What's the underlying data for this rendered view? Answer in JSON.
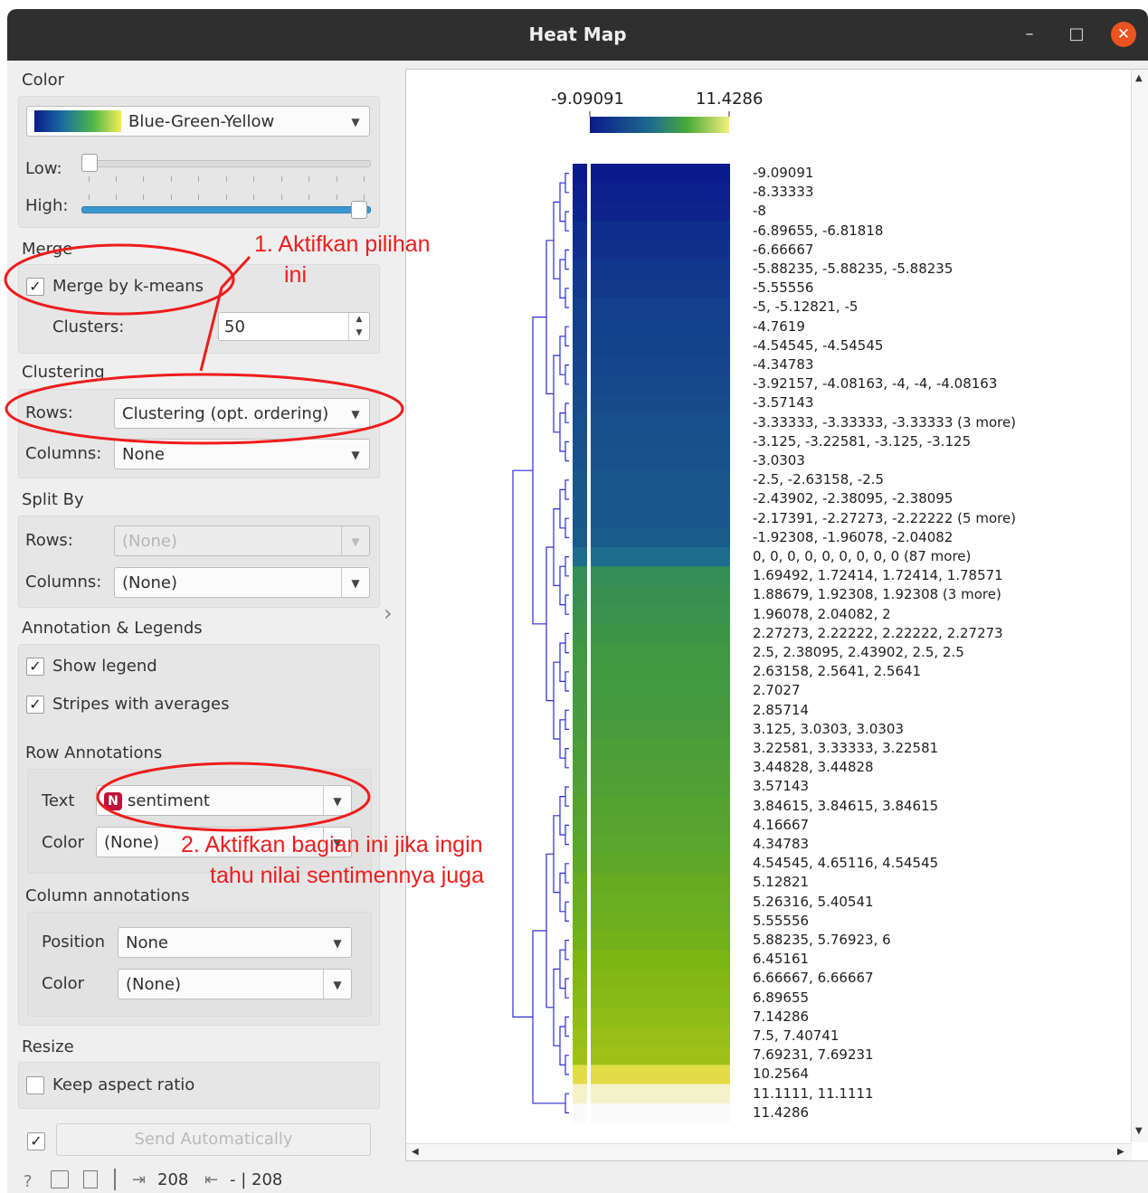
{
  "window": {
    "title": "Heat Map",
    "buttons": {
      "minimize": "–",
      "maximize": "□",
      "close": "✕"
    }
  },
  "color_section": {
    "label": "Color",
    "palette": "Blue-Green-Yellow",
    "low_label": "Low:",
    "high_label": "High:",
    "low_value": 0.0,
    "high_value": 1.0
  },
  "merge_section": {
    "label": "Merge",
    "checkbox_label": "Merge by k-means",
    "checked": true,
    "clusters_label": "Clusters:",
    "clusters_value": "50"
  },
  "clustering_section": {
    "label": "Clustering",
    "rows_label": "Rows:",
    "rows_value": "Clustering (opt. ordering)",
    "columns_label": "Columns:",
    "columns_value": "None"
  },
  "split_section": {
    "label": "Split By",
    "rows_label": "Rows:",
    "rows_value": "(None)",
    "columns_label": "Columns:",
    "columns_value": "(None)"
  },
  "annotation_section": {
    "label": "Annotation & Legends",
    "show_legend": "Show legend",
    "show_legend_checked": true,
    "stripes": "Stripes with averages",
    "stripes_checked": true,
    "row_annotations_label": "Row Annotations",
    "text_label": "Text",
    "text_badge": "N",
    "text_value": "sentiment",
    "color_label": "Color",
    "color_value": "(None)",
    "column_annotations_label": "Column annotations",
    "position_label": "Position",
    "position_value": "None",
    "col_color_label": "Color",
    "col_color_value": "(None)"
  },
  "resize_section": {
    "label": "Resize",
    "keep_aspect": "Keep aspect ratio",
    "keep_aspect_checked": false
  },
  "footer": {
    "send_auto": "Send Automatically",
    "send_checked": true,
    "input_count": "208",
    "output_count": "- | 208"
  },
  "annotations": {
    "note1_line1": "1. Aktifkan pilihan",
    "note1_line2": "ini",
    "note2_line1": "2. Aktifkan bagian ini jika ingin",
    "note2_line2": "tahu nilai sentimennya juga"
  },
  "chart_data": {
    "type": "heatmap",
    "legend_min": "-9.09091",
    "legend_max": "11.4286",
    "colors": {
      "low": "#0a1a8c",
      "mid": "#2a8f5a",
      "high": "#f2ee7a"
    },
    "row_labels": [
      "-9.09091",
      "-8.33333",
      "-8",
      "-6.89655, -6.81818",
      "-6.66667",
      "-5.88235, -5.88235, -5.88235",
      "-5.55556",
      "-5, -5.12821, -5",
      "-4.7619",
      "-4.54545, -4.54545",
      "-4.34783",
      "-3.92157, -4.08163, -4, -4, -4.08163",
      "-3.57143",
      "-3.33333, -3.33333, -3.33333 (3 more)",
      "-3.125, -3.22581, -3.125, -3.125",
      "-3.0303",
      "-2.5, -2.63158, -2.5",
      "-2.43902, -2.38095, -2.38095",
      "-2.17391, -2.27273, -2.22222 (5 more)",
      "-1.92308, -1.96078, -2.04082",
      "0, 0, 0, 0, 0, 0, 0, 0, 0 (87 more)",
      "1.69492, 1.72414, 1.72414, 1.78571",
      "1.88679, 1.92308, 1.92308 (3 more)",
      "1.96078, 2.04082, 2",
      "2.27273, 2.22222, 2.22222, 2.27273",
      "2.5, 2.38095, 2.43902, 2.5, 2.5",
      "2.63158, 2.5641, 2.5641",
      "2.7027",
      "2.85714",
      "3.125, 3.0303, 3.0303",
      "3.22581, 3.33333, 3.22581",
      "3.44828, 3.44828",
      "3.57143",
      "3.84615, 3.84615, 3.84615",
      "4.16667",
      "4.34783",
      "4.54545, 4.65116, 4.54545",
      "5.12821",
      "5.26316, 5.40541",
      "5.55556",
      "5.88235, 5.76923, 6",
      "6.45161",
      "6.66667, 6.66667",
      "6.89655",
      "7.14286",
      "7.5, 7.40741",
      "7.69231, 7.69231",
      "10.2564",
      "11.1111, 11.1111",
      "11.4286"
    ],
    "row_values": [
      -9.09091,
      -8.33333,
      -8,
      -6.855,
      -6.66667,
      -5.88235,
      -5.55556,
      -5.04,
      -4.7619,
      -4.54545,
      -4.34783,
      -4.017,
      -3.57143,
      -3.33333,
      -3.15,
      -3.0303,
      -2.544,
      -2.4,
      -2.23,
      -1.975,
      0,
      1.73,
      1.91,
      2.0,
      2.25,
      2.46,
      2.59,
      2.7027,
      2.85714,
      3.06,
      3.26,
      3.44828,
      3.57143,
      3.84615,
      4.16667,
      4.34783,
      4.58,
      5.12821,
      5.33,
      5.55556,
      5.88,
      6.45161,
      6.66667,
      6.89655,
      7.14286,
      7.45,
      7.69231,
      10.2564,
      11.1111,
      11.4286
    ]
  }
}
